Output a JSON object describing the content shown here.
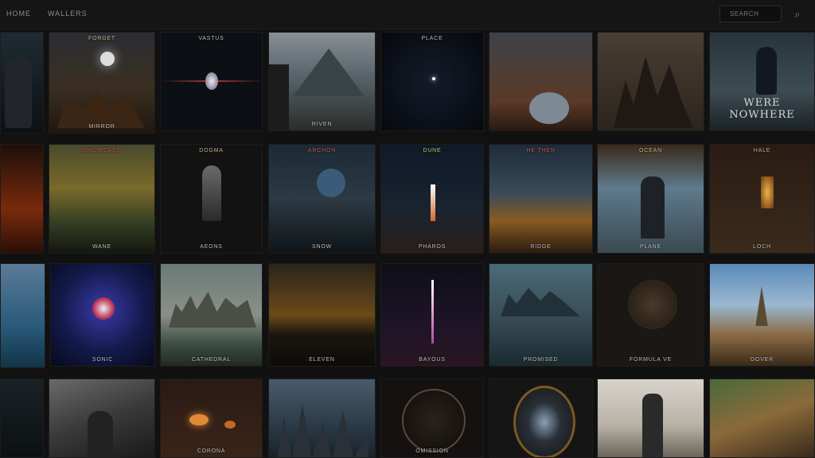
{
  "nav": {
    "home_label": "HOME",
    "wallpapers_label": "WALLERS"
  },
  "search": {
    "placeholder": "SEARCH"
  },
  "icons": {
    "search": "search-icon"
  },
  "tiles": [
    {
      "caption": ""
    },
    {
      "caption_top": "FORGET",
      "caption": "MIRROR"
    },
    {
      "caption_top": "VASTUS",
      "caption": ""
    },
    {
      "caption": "RIVEN"
    },
    {
      "caption_top": "PLACE",
      "caption": ""
    },
    {
      "caption": ""
    },
    {
      "caption": ""
    },
    {
      "caption": "WERE NOWHERE"
    },
    {
      "caption": ""
    },
    {
      "caption_top": "SHOWCASE",
      "caption": "WANE"
    },
    {
      "caption_top": "DOGMA",
      "caption": "AEONS"
    },
    {
      "caption_top": "ARCHON",
      "caption": "SNOW"
    },
    {
      "caption_top": "DUNE",
      "caption": "PHAROS"
    },
    {
      "caption_top": "HE THEN",
      "caption": "RIDGE"
    },
    {
      "caption_top": "OCEAN",
      "caption": "PLANE"
    },
    {
      "caption_top": "HALE",
      "caption": "LOCH"
    },
    {
      "caption": ""
    },
    {
      "caption": "SONIC"
    },
    {
      "caption": "CATHEDRAL"
    },
    {
      "caption": "ELEVEN"
    },
    {
      "caption": "BAYOUS"
    },
    {
      "caption": "PROMISED"
    },
    {
      "caption": "FORMULA VE"
    },
    {
      "caption": "DOVER"
    },
    {
      "caption": ""
    },
    {
      "caption": ""
    },
    {
      "caption": "CORONA"
    },
    {
      "caption": ""
    },
    {
      "caption": "OMISSION"
    },
    {
      "caption": ""
    },
    {
      "caption": ""
    },
    {
      "caption": ""
    }
  ]
}
